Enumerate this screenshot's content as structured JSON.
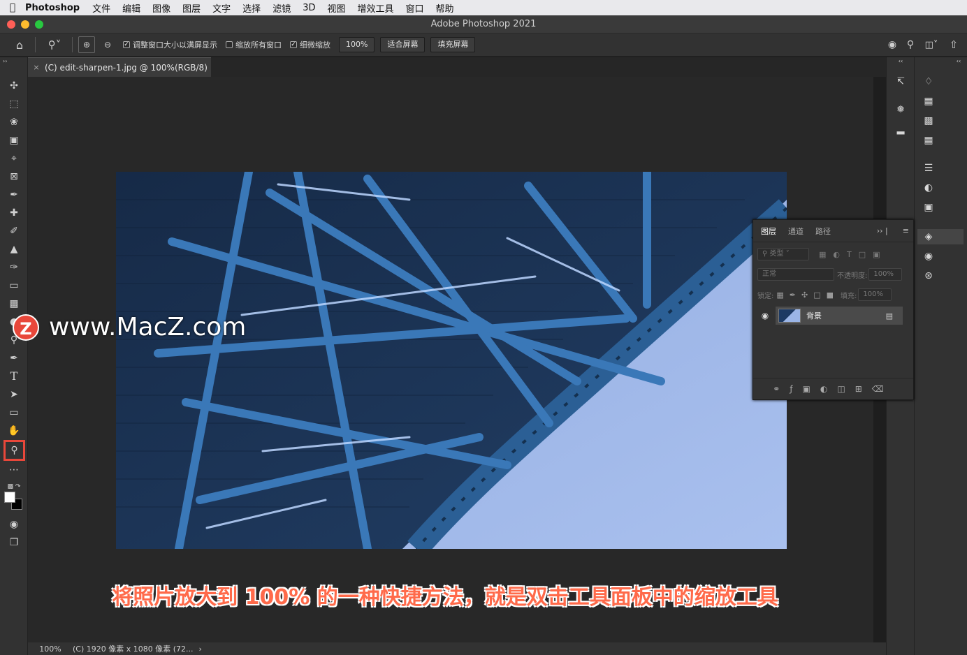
{
  "menubar": {
    "app": "Photoshop",
    "items": [
      "文件",
      "编辑",
      "图像",
      "图层",
      "文字",
      "选择",
      "滤镜",
      "3D",
      "视图",
      "增效工具",
      "窗口",
      "帮助"
    ]
  },
  "window": {
    "title": "Adobe Photoshop 2021"
  },
  "options": {
    "resize_windows": "调整窗口大小以满屏显示",
    "zoom_all": "缩放所有窗口",
    "scrubby": "细微缩放",
    "zoom_value": "100%",
    "fit_screen": "适合屏幕",
    "fill_screen": "填充屏幕",
    "resize_checked": true,
    "zoom_all_checked": false,
    "scrubby_checked": true
  },
  "document": {
    "tab": "(C) edit-sharpen-1.jpg @ 100%(RGB/8)"
  },
  "status": {
    "zoom": "100%",
    "info": "(C) 1920 像素 x 1080 像素 (72..."
  },
  "layers_panel": {
    "tabs": [
      "图层",
      "通道",
      "路径"
    ],
    "filter": "类型",
    "blend": "正常",
    "opacity_label": "不透明度:",
    "opacity_value": "100%",
    "lock_label": "锁定:",
    "fill_label": "填充:",
    "fill_value": "100%",
    "layer_name": "背景"
  },
  "caption": "将照片放大到 100% 的一种快捷方法，就是双击工具面板中的缩放工具",
  "watermark": {
    "logo": "Z",
    "text": "www.MacZ.com"
  },
  "colors": {
    "highlight": "#e8473a",
    "caption": "#ff6a4a",
    "sky": "#9bb5e6",
    "steel": "#1e3f66"
  }
}
